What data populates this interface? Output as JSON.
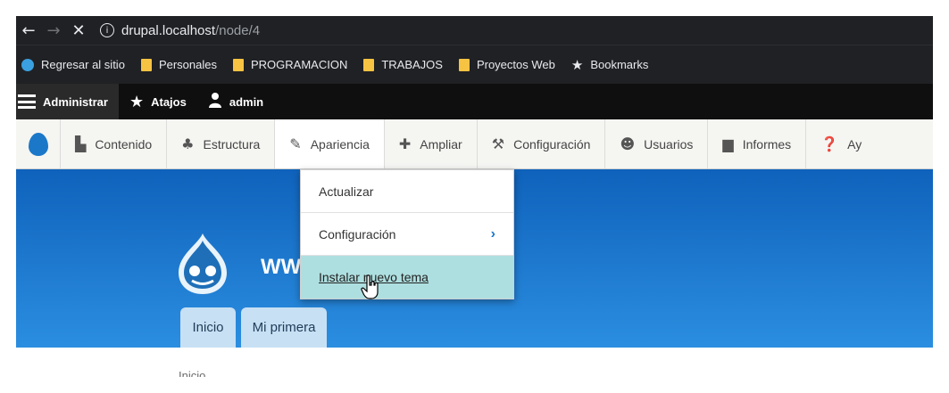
{
  "browser": {
    "nav": {
      "back": "←",
      "forward": "→",
      "stop": "✕"
    },
    "url_host": "drupal.localhost",
    "url_path": "/node/4"
  },
  "bookmarks": [
    {
      "label": "Regresar al sitio",
      "icon": "drupal-icon"
    },
    {
      "label": "Personales",
      "icon": "folder-icon"
    },
    {
      "label": "PROGRAMACION",
      "icon": "folder-icon"
    },
    {
      "label": "TRABAJOS",
      "icon": "folder-icon"
    },
    {
      "label": "Proyectos Web",
      "icon": "folder-icon"
    },
    {
      "label": "Bookmarks",
      "icon": "star-icon"
    }
  ],
  "toolbar": {
    "admin": "Administrar",
    "shortcuts": "Atajos",
    "user": "admin"
  },
  "tray": {
    "items": [
      "Contenido",
      "Estructura",
      "Apariencia",
      "Ampliar",
      "Configuración",
      "Usuarios",
      "Informes",
      "Ay"
    ]
  },
  "dropdown": {
    "items": [
      "Actualizar",
      "Configuración",
      "Instalar nuevo tema"
    ]
  },
  "hero": {
    "site_name": "WW",
    "tabs": [
      "Inicio",
      "Mi primera"
    ]
  },
  "breadcrumb": "Inicio",
  "colors": {
    "toolbar": "#0f0f0f",
    "hero": "#1b78c9",
    "hover": "#aedfe0",
    "drupal_blue": "#1b78c9"
  }
}
